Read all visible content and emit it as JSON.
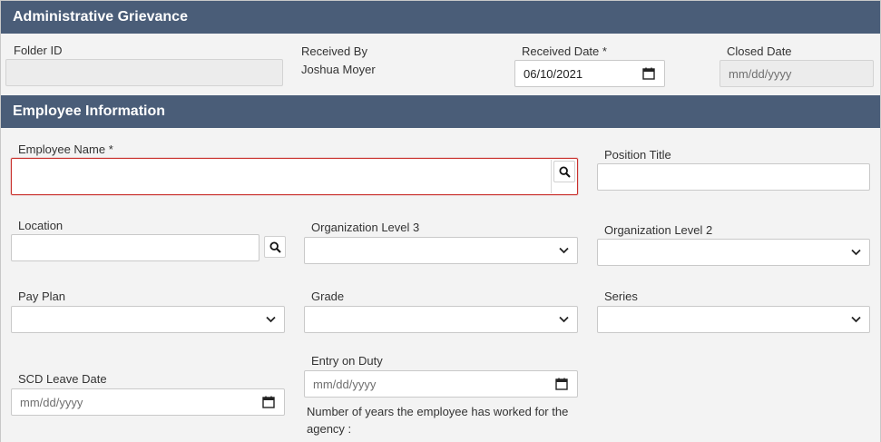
{
  "sections": {
    "grievance_title": "Administrative Grievance",
    "employee_title": "Employee Information"
  },
  "fields": {
    "folder_id": {
      "label": "Folder ID",
      "value": ""
    },
    "received_by": {
      "label": "Received By",
      "value": "Joshua Moyer"
    },
    "received_date": {
      "label": "Received Date *",
      "value": "06/10/2021"
    },
    "closed_date": {
      "label": "Closed Date",
      "placeholder": "mm/dd/yyyy"
    },
    "employee_name": {
      "label": "Employee Name *",
      "value": ""
    },
    "position_title": {
      "label": "Position Title",
      "value": ""
    },
    "location": {
      "label": "Location",
      "value": ""
    },
    "org_level_3": {
      "label": "Organization Level 3",
      "value": ""
    },
    "org_level_2": {
      "label": "Organization Level 2",
      "value": ""
    },
    "pay_plan": {
      "label": "Pay Plan",
      "value": ""
    },
    "grade": {
      "label": "Grade",
      "value": ""
    },
    "series": {
      "label": "Series",
      "value": ""
    },
    "scd_leave_date": {
      "label": "SCD Leave Date",
      "placeholder": "mm/dd/yyyy"
    },
    "entry_on_duty": {
      "label": "Entry on Duty",
      "placeholder": "mm/dd/yyyy"
    }
  },
  "notes": {
    "years_worked_line1": "Number of years the employee has worked for the",
    "years_worked_line2": "agency :"
  },
  "colors": {
    "header_bg": "#4a5d78",
    "error_border": "#c9302c"
  },
  "icons": {
    "search": "magnifier",
    "calendar": "calendar",
    "dropdown": "chevron-down"
  }
}
